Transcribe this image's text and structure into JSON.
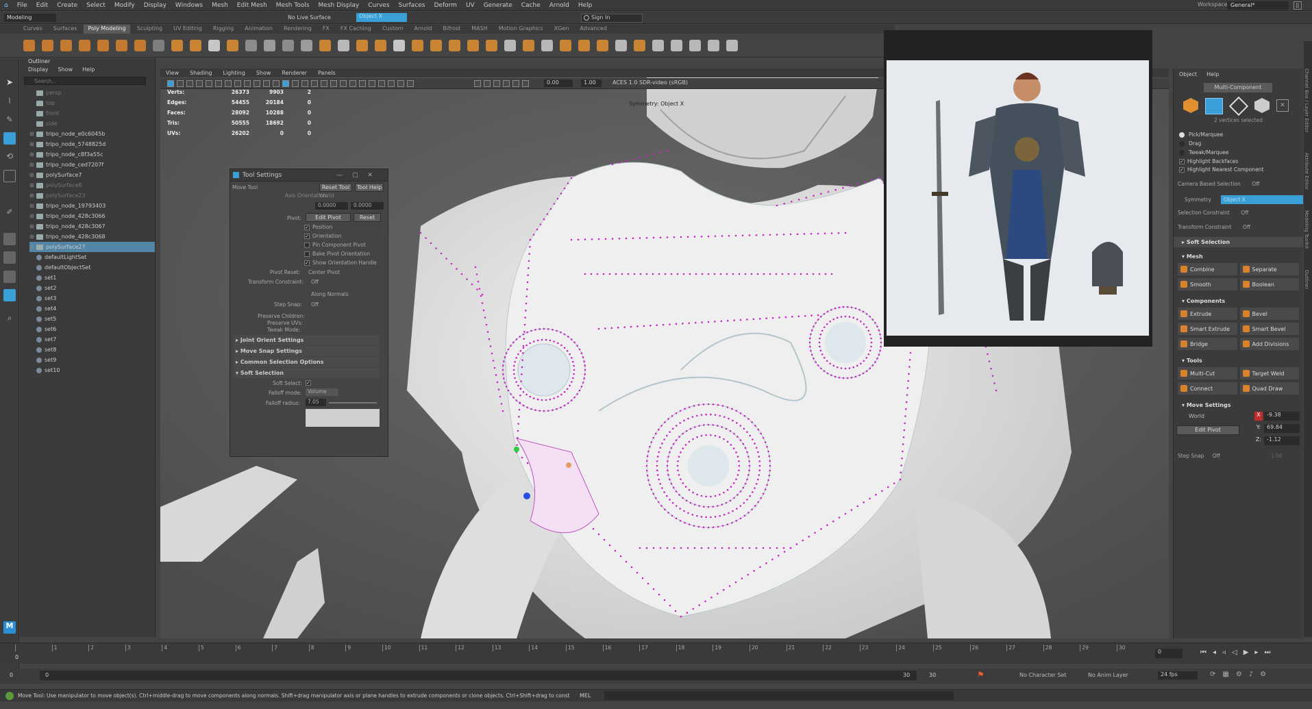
{
  "menubar": {
    "items": [
      "File",
      "Edit",
      "Create",
      "Select",
      "Modify",
      "Display",
      "Windows",
      "Mesh",
      "Edit Mesh",
      "Mesh Tools",
      "Mesh Display",
      "Curves",
      "Surfaces",
      "Deform",
      "UV",
      "Generate",
      "Cache",
      "Arnold",
      "Help"
    ],
    "workspace_label": "Workspace:",
    "workspace_value": "General*"
  },
  "statusline": {
    "mode": "Modeling",
    "live_surface": "No Live Surface",
    "symmetry": "Object X",
    "sign_in": "Sign In"
  },
  "shelf": {
    "tabs": [
      "Curves",
      "Surfaces",
      "Poly Modeling",
      "Sculpting",
      "UV Editing",
      "Rigging",
      "Animation",
      "Rendering",
      "FX",
      "FX Caching",
      "Custom",
      "Arnold",
      "Bifrost",
      "MASH",
      "Motion Graphics",
      "XGen",
      "Advanced"
    ],
    "active_tab": "Poly Modeling"
  },
  "outliner": {
    "title": "Outliner",
    "menu": [
      "Display",
      "Show",
      "Help"
    ],
    "search_placeholder": "Search...",
    "items": [
      "persp",
      "top",
      "front",
      "side",
      "tripo_node_e0c6045b",
      "tripo_node_5748825d",
      "tripo_node_c8f3a55c",
      "tripo_node_ced7207f",
      "polySurface7",
      "polySurface8",
      "polySurface23",
      "tripo_node_19793403",
      "tripo_node_428c3066",
      "tripo_node_428c3067",
      "tripo_node_428c3068",
      "polySurface27",
      "defaultLightSet",
      "defaultObjectSet",
      "set1",
      "set2",
      "set3",
      "set4",
      "set5",
      "set6",
      "set7",
      "set8",
      "set9",
      "set10"
    ],
    "selected": "polySurface27"
  },
  "viewport": {
    "menu": [
      "View",
      "Shading",
      "Lighting",
      "Show",
      "Renderer",
      "Panels"
    ],
    "exposure": "0.00",
    "gamma": "1.00",
    "colorspace": "ACES 1.0 SDR-video (sRGB)",
    "symmetry_label": "Symmetry: Object X",
    "hud": [
      {
        "label": "Verts:",
        "a": "26373",
        "b": "9903",
        "c": "2"
      },
      {
        "label": "Edges:",
        "a": "54455",
        "b": "20184",
        "c": "0"
      },
      {
        "label": "Faces:",
        "a": "28092",
        "b": "10288",
        "c": "0"
      },
      {
        "label": "Tris:",
        "a": "50555",
        "b": "18692",
        "c": "0"
      },
      {
        "label": "UVs:",
        "a": "26202",
        "b": "0",
        "c": "0"
      }
    ]
  },
  "tool_settings": {
    "title": "Tool Settings",
    "tool_name": "Move Tool",
    "reset_tool": "Reset Tool",
    "tool_help": "Tool Help",
    "axis_orientation_label": "Axis Orientation:",
    "axis_orientation_value": "World",
    "value_a": "0.0000",
    "value_b": "0.0000",
    "pivot_label": "Pivot:",
    "edit_pivot": "Edit Pivot",
    "reset": "Reset",
    "checks": [
      {
        "label": "Position",
        "checked": true
      },
      {
        "label": "Orientation",
        "checked": true
      },
      {
        "label": "Pin Component Pivot",
        "checked": false
      },
      {
        "label": "Bake Pivot Orientation",
        "checked": false
      },
      {
        "label": "Show Orientation Handle",
        "checked": true
      }
    ],
    "pivot_reset_label": "Pivot Reset:",
    "pivot_reset_value": "Center Pivot",
    "transform_constraint_label": "Transform Constraint:",
    "transform_constraint_value": "Off",
    "along_normals": "Along Normals",
    "step_snap_label": "Step Snap:",
    "step_snap_value": "Off",
    "preserve_children": "Preserve Children:",
    "preserve_uvs": "Preserve UVs:",
    "tweak_mode": "Tweak Mode:",
    "sections": [
      "Joint Orient Settings",
      "Move Snap Settings",
      "Common Selection Options",
      "Soft Selection"
    ],
    "soft_select_label": "Soft Select:",
    "falloff_mode_label": "Falloff mode:",
    "falloff_mode_value": "Volume",
    "falloff_radius_label": "Falloff radius:",
    "falloff_radius_value": "7.05"
  },
  "modeling_toolkit": {
    "menu": [
      "Object",
      "Help"
    ],
    "multi_component": "Multi-Component",
    "vertices_selected": "2 vertices selected",
    "pick_options": [
      "Pick/Marquee",
      "Drag",
      "Tweak/Marquee"
    ],
    "highlight_backfaces": "Highlight Backfaces",
    "highlight_nearest": "Highlight Nearest Component",
    "camera_based_label": "Camera Based Selection",
    "camera_based_value": "Off",
    "symmetry_label": "Symmetry",
    "symmetry_value": "Object X",
    "selection_constraint_label": "Selection Constraint",
    "selection_constraint_value": "Off",
    "transform_constraint_label": "Transform Constraint",
    "transform_constraint_value": "Off",
    "soft_selection": "Soft Selection",
    "mesh_section": "Mesh",
    "mesh_buttons": [
      "Combine",
      "Separate",
      "Smooth",
      "Boolean"
    ],
    "components_section": "Components",
    "component_buttons": [
      "Extrude",
      "Bevel",
      "Smart Extrude",
      "Smart Bevel",
      "Bridge",
      "Add Divisions"
    ],
    "tools_section": "Tools",
    "tool_buttons": [
      "Multi-Cut",
      "Target Weld",
      "Connect",
      "Quad Draw"
    ],
    "move_settings_section": "Move Settings",
    "space_value": "World",
    "x_value": "-9.38",
    "y_value": "69.84",
    "z_value": "-1.12",
    "edit_pivot": "Edit Pivot",
    "step_snap_label": "Step Snap",
    "step_snap_value": "Off",
    "step_snap_number": "1.00"
  },
  "side_rail_labels": [
    "Channel Box / Layer Editor",
    "Attribute Editor",
    "Modeling Toolkit",
    "Outliner"
  ],
  "timeline": {
    "ticks": [
      "0",
      "1",
      "2",
      "3",
      "4",
      "5",
      "6",
      "7",
      "8",
      "9",
      "10",
      "11",
      "12",
      "13",
      "14",
      "15",
      "16",
      "17",
      "18",
      "19",
      "20",
      "21",
      "22",
      "23",
      "24",
      "25",
      "26",
      "27",
      "28",
      "29",
      "30"
    ],
    "current_frame_field": "0",
    "current_frame_marker": "0"
  },
  "range": {
    "start": "0",
    "start_inner": "0",
    "end_inner": "30",
    "end": "30",
    "character_set": "No Character Set",
    "anim_layer": "No Anim Layer",
    "fps": "24 fps"
  },
  "helpline": {
    "text": "Move Tool: Use manipulator to move object(s). Ctrl+middle-drag to move components along normals. Shift+drag manipulator axis or plane handles to extrude components or clone objects. Ctrl+Shift+drag to constrain movement to a co",
    "mel": "MEL"
  },
  "colors": {
    "selection_highlight": "#5285a6",
    "vertex_dot": "#d42bd4",
    "maya_blue": "#3a9fd6",
    "field_x": "#c42b2b"
  }
}
